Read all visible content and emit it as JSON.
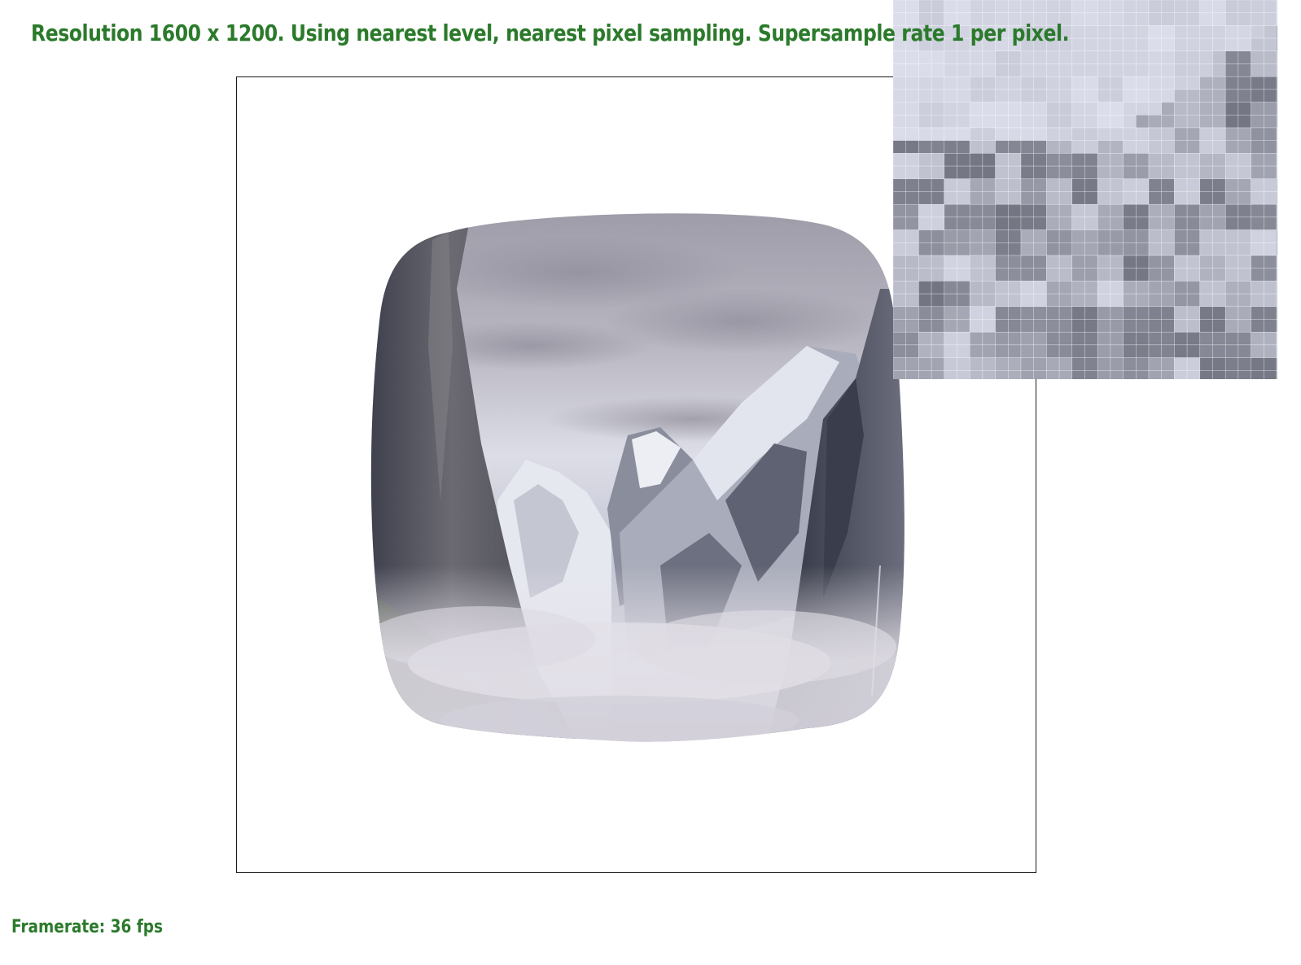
{
  "status": {
    "title_text": "Resolution 1600 x 1200. Using nearest level, nearest pixel sampling. Supersample rate 1 per pixel.",
    "framerate_text": "Framerate: 36 fps"
  },
  "colors": {
    "status_text": "#2b7a2b",
    "viewport_border": "#1a1a1a",
    "background": "#ffffff",
    "sky": "#c9cad6",
    "cliff_dark": "#4a4d5c",
    "snow": "#e4e6ef",
    "mist": "#d7d4dd",
    "zoom_grid_line": "#ffffff"
  },
  "zoom": {
    "description_icon": "pixel-inspector-grid"
  }
}
